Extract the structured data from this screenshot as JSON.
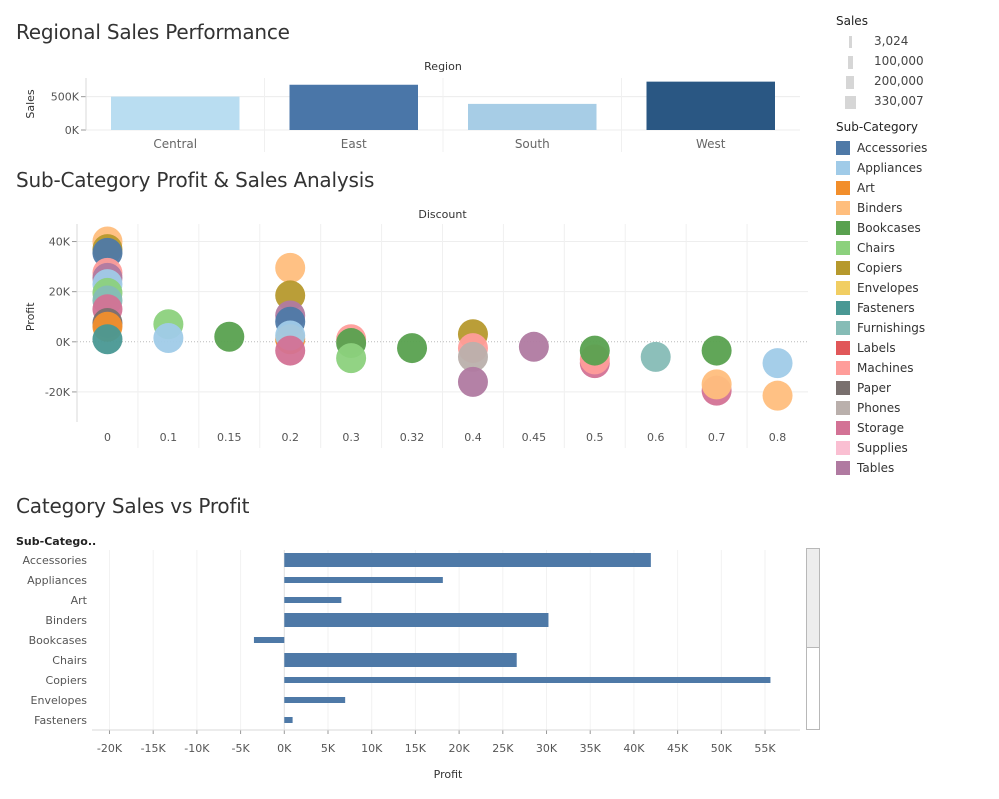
{
  "titles": {
    "region": "Regional Sales Performance",
    "subcat": "Sub-Category Profit & Sales Analysis",
    "category": "Category Sales vs Profit"
  },
  "legend": {
    "size_title": "Sales",
    "size_items": [
      "3,024",
      "100,000",
      "200,000",
      "330,007"
    ],
    "color_title": "Sub-Category",
    "color_items": [
      {
        "label": "Accessories",
        "color": "#4e79a7"
      },
      {
        "label": "Appliances",
        "color": "#a0cbe8"
      },
      {
        "label": "Art",
        "color": "#f28e2b"
      },
      {
        "label": "Binders",
        "color": "#ffbe7d"
      },
      {
        "label": "Bookcases",
        "color": "#59a14f"
      },
      {
        "label": "Chairs",
        "color": "#8cd17d"
      },
      {
        "label": "Copiers",
        "color": "#b6992d"
      },
      {
        "label": "Envelopes",
        "color": "#f1ce63"
      },
      {
        "label": "Fasteners",
        "color": "#499894"
      },
      {
        "label": "Furnishings",
        "color": "#86bcb6"
      },
      {
        "label": "Labels",
        "color": "#e15759"
      },
      {
        "label": "Machines",
        "color": "#ff9d9a"
      },
      {
        "label": "Paper",
        "color": "#79706e"
      },
      {
        "label": "Phones",
        "color": "#bab0ac"
      },
      {
        "label": "Storage",
        "color": "#d37295"
      },
      {
        "label": "Supplies",
        "color": "#fabfd2"
      },
      {
        "label": "Tables",
        "color": "#b07aa1"
      }
    ]
  },
  "chart_data": [
    {
      "type": "bar",
      "title": "Regional Sales Performance",
      "column_header": "Region",
      "ylabel": "Sales",
      "categories": [
        "Central",
        "East",
        "South",
        "West"
      ],
      "values": [
        501240,
        678781,
        391722,
        725458
      ],
      "colors": [
        "#b9ddf1",
        "#4a76a8",
        "#a7cde6",
        "#2a5783"
      ],
      "y_ticks": [
        0,
        500000
      ],
      "y_tick_labels": [
        "0K",
        "500K"
      ],
      "ylim": [
        0,
        780000
      ],
      "grid": true
    },
    {
      "type": "scatter",
      "title": "Sub-Category Profit & Sales Analysis",
      "column_header": "Discount",
      "ylabel": "Profit",
      "discount_columns": [
        "0",
        "0.1",
        "0.15",
        "0.2",
        "0.3",
        "0.32",
        "0.4",
        "0.45",
        "0.5",
        "0.6",
        "0.7",
        "0.8"
      ],
      "y_ticks": [
        -20000,
        0,
        20000,
        40000
      ],
      "y_tick_labels": [
        "-20K",
        "0K",
        "20K",
        "40K"
      ],
      "ylim": [
        -32000,
        47000
      ],
      "points": [
        {
          "d": "0",
          "cat": "Binders",
          "y": 40000
        },
        {
          "d": "0",
          "cat": "Copiers",
          "y": 37000
        },
        {
          "d": "0",
          "cat": "Accessories",
          "y": 35500
        },
        {
          "d": "0",
          "cat": "Machines",
          "y": 27500
        },
        {
          "d": "0",
          "cat": "Tables",
          "y": 25500
        },
        {
          "d": "0",
          "cat": "Appliances",
          "y": 23000
        },
        {
          "d": "0",
          "cat": "Chairs",
          "y": 19500
        },
        {
          "d": "0",
          "cat": "Furnishings",
          "y": 16500
        },
        {
          "d": "0",
          "cat": "Storage",
          "y": 13000
        },
        {
          "d": "0",
          "cat": "Paper",
          "y": 7500
        },
        {
          "d": "0",
          "cat": "Art",
          "y": 6000
        },
        {
          "d": "0",
          "cat": "Fasteners",
          "y": 1000
        },
        {
          "d": "0.1",
          "cat": "Chairs",
          "y": 7000
        },
        {
          "d": "0.1",
          "cat": "Appliances",
          "y": 1500
        },
        {
          "d": "0.15",
          "cat": "Bookcases",
          "y": 2000
        },
        {
          "d": "0.2",
          "cat": "Binders",
          "y": 29500
        },
        {
          "d": "0.2",
          "cat": "Copiers",
          "y": 18500
        },
        {
          "d": "0.2",
          "cat": "Tables",
          "y": 10500
        },
        {
          "d": "0.2",
          "cat": "Accessories",
          "y": 8000
        },
        {
          "d": "0.2",
          "cat": "Art",
          "y": 1000
        },
        {
          "d": "0.2",
          "cat": "Appliances",
          "y": 2500
        },
        {
          "d": "0.2",
          "cat": "Storage",
          "y": -3500
        },
        {
          "d": "0.3",
          "cat": "Machines",
          "y": 1000
        },
        {
          "d": "0.3",
          "cat": "Bookcases",
          "y": -500
        },
        {
          "d": "0.3",
          "cat": "Chairs",
          "y": -6500
        },
        {
          "d": "0.32",
          "cat": "Bookcases",
          "y": -2500
        },
        {
          "d": "0.4",
          "cat": "Copiers",
          "y": 3000
        },
        {
          "d": "0.4",
          "cat": "Machines",
          "y": -2500
        },
        {
          "d": "0.4",
          "cat": "Phones",
          "y": -6000
        },
        {
          "d": "0.4",
          "cat": "Tables",
          "y": -16000
        },
        {
          "d": "0.45",
          "cat": "Tables",
          "y": -2000
        },
        {
          "d": "0.5",
          "cat": "Storage",
          "y": -8500
        },
        {
          "d": "0.5",
          "cat": "Machines",
          "y": -7000
        },
        {
          "d": "0.5",
          "cat": "Bookcases",
          "y": -3500
        },
        {
          "d": "0.6",
          "cat": "Furnishings",
          "y": -6000
        },
        {
          "d": "0.7",
          "cat": "Bookcases",
          "y": -3500
        },
        {
          "d": "0.7",
          "cat": "Storage",
          "y": -19500
        },
        {
          "d": "0.7",
          "cat": "Binders",
          "y": -17000
        },
        {
          "d": "0.8",
          "cat": "Appliances",
          "y": -8500
        },
        {
          "d": "0.8",
          "cat": "Binders",
          "y": -21500
        }
      ],
      "grid": true
    },
    {
      "type": "bar",
      "title": "Category Sales vs Profit",
      "row_header": "Sub-Catego..",
      "xlabel": "Profit",
      "categories": [
        "Accessories",
        "Appliances",
        "Art",
        "Binders",
        "Bookcases",
        "Chairs",
        "Copiers",
        "Envelopes",
        "Fasteners"
      ],
      "values": [
        41937,
        18138,
        6528,
        30222,
        -3473,
        26590,
        55618,
        6964,
        950
      ],
      "thick": [
        true,
        false,
        false,
        true,
        false,
        true,
        false,
        false,
        false
      ],
      "x_ticks": [
        -20000,
        -15000,
        -10000,
        -5000,
        0,
        5000,
        10000,
        15000,
        20000,
        25000,
        30000,
        35000,
        40000,
        45000,
        50000,
        55000
      ],
      "x_tick_labels": [
        "-20K",
        "-15K",
        "-10K",
        "-5K",
        "0K",
        "5K",
        "10K",
        "15K",
        "20K",
        "25K",
        "30K",
        "35K",
        "40K",
        "45K",
        "50K",
        "55K"
      ],
      "xlim": [
        -22000,
        59000
      ],
      "color": "#4e79a7",
      "grid": true
    }
  ]
}
